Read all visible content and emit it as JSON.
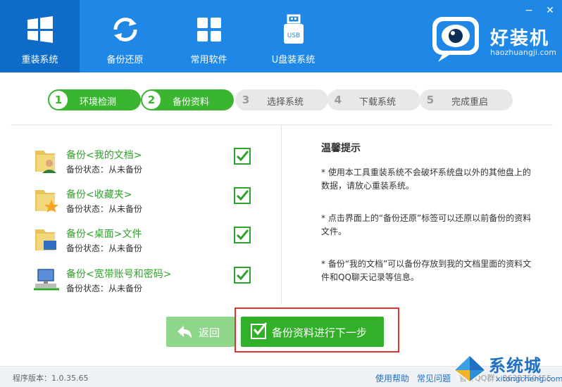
{
  "window": {
    "minimize_glyph": "−",
    "close_glyph": "✕"
  },
  "nav": {
    "items": [
      {
        "label": "重装系统",
        "icon": "windows-icon",
        "active": true
      },
      {
        "label": "备份还原",
        "icon": "refresh-icon",
        "active": false
      },
      {
        "label": "常用软件",
        "icon": "apps-grid-icon",
        "active": false
      },
      {
        "label": "U盘装系统",
        "icon": "usb-drive-icon",
        "active": false
      }
    ],
    "usb_text": "USB"
  },
  "brand": {
    "title": "好装机",
    "url": "haozhuangji.com"
  },
  "steps": [
    {
      "num": "1",
      "label": "环境检测",
      "state": "done"
    },
    {
      "num": "2",
      "label": "备份资料",
      "state": "done"
    },
    {
      "num": "3",
      "label": "选择系统",
      "state": "todo"
    },
    {
      "num": "4",
      "label": "下载系统",
      "state": "todo"
    },
    {
      "num": "5",
      "label": "完成重启",
      "state": "todo"
    }
  ],
  "backup_items": [
    {
      "title": "备份<我的文档>",
      "status": "备份状态：从未备份",
      "icon": "user-folder-icon",
      "checked": true
    },
    {
      "title": "备份<收藏夹>",
      "status": "备份状态：从未备份",
      "icon": "favorites-folder-icon",
      "checked": true
    },
    {
      "title": "备份<桌面>文件",
      "status": "备份状态：从未备份",
      "icon": "desktop-folder-icon",
      "checked": true
    },
    {
      "title": "备份<宽带账号和密码>",
      "status": "备份状态：从未备份",
      "icon": "network-computer-icon",
      "checked": true
    }
  ],
  "tips": {
    "title": "温馨提示",
    "items": [
      "* 使用本工具重装系统不会破坏系统盘以外的其他盘上的数据，请放心重装系统。",
      "* 点击界面上的“备份还原”标签可以还原以前备份的资料文件。",
      "* 备份“我的文档”可以备份存放到我的文档里面的资料文件和QQ聊天记录等信息。"
    ]
  },
  "buttons": {
    "back": "返回",
    "next": "备份资料进行下一步"
  },
  "footer": {
    "version": "程序版本：1.0.35.65",
    "help": "使用帮助",
    "faq": "常见问题",
    "qq_partial": "官方QQ群：3638750455"
  },
  "watermark": {
    "text": "系统城",
    "sub": "xitongcheng.com"
  },
  "colors": {
    "header": "#1f87e6",
    "header_active": "#0e6cc8",
    "step_done": "#3ab52f",
    "step_todo": "#e8e8e8",
    "accent_green": "#33b029",
    "back_button": "#8ed68a",
    "highlight_red": "#e0322f"
  }
}
